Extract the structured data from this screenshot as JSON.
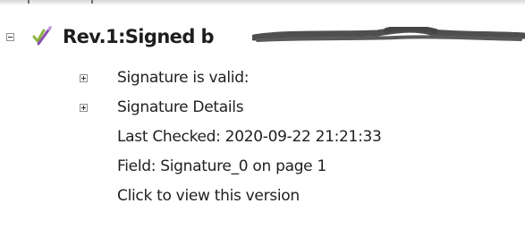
{
  "signature_tree": {
    "revision": {
      "title": "Rev.1:Signed b",
      "icons": {
        "collapse": "collapse-minus-icon",
        "signature": "signature-check-pen-icon"
      },
      "children": [
        {
          "label": "Signature is valid:",
          "expandable": true
        },
        {
          "label": "Signature Details",
          "expandable": true
        },
        {
          "label": "Last Checked: 2020-09-22 21:21:33",
          "expandable": false
        },
        {
          "label": "Field: Signature_0 on page 1",
          "expandable": false
        },
        {
          "label": "Click to view this version",
          "expandable": false
        }
      ]
    }
  },
  "colors": {
    "check_mark": "#8db33f",
    "pen": "#8a4fb0",
    "redaction": "#4f4f4f",
    "text": "#1f1f1f"
  }
}
